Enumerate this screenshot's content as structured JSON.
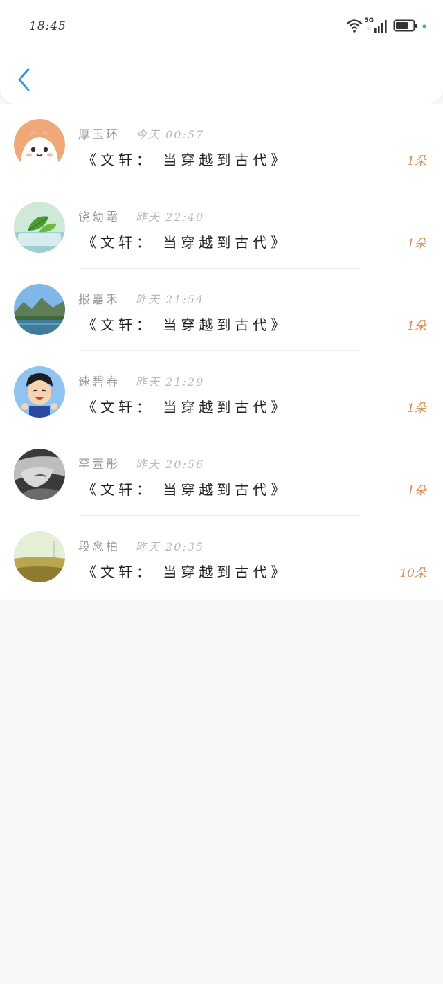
{
  "status_bar": {
    "time": "18:45",
    "network": "5G",
    "network_sub": "1l"
  },
  "nav": {
    "back_icon": "chevron-left-icon",
    "accent": "#3d97e4"
  },
  "records": [
    {
      "name": "厚玉环",
      "time": "今天 00:57",
      "book": "《文轩： 当穿越到古代》",
      "count": "1朵"
    },
    {
      "name": "饶幼霜",
      "time": "昨天 22:40",
      "book": "《文轩： 当穿越到古代》",
      "count": "1朵"
    },
    {
      "name": "报嘉禾",
      "time": "昨天 21:54",
      "book": "《文轩： 当穿越到古代》",
      "count": "1朵"
    },
    {
      "name": "速碧春",
      "time": "昨天 21:29",
      "book": "《文轩： 当穿越到古代》",
      "count": "1朵"
    },
    {
      "name": "罕萱彤",
      "time": "昨天 20:56",
      "book": "《文轩： 当穿越到古代》",
      "count": "1朵"
    },
    {
      "name": "段念柏",
      "time": "昨天 20:35",
      "book": "《文轩： 当穿越到古代》",
      "count": "10朵"
    }
  ],
  "colors": {
    "name": "#9a9a9a",
    "time": "#b9b9b9",
    "book": "#222222",
    "count": "#d6915a"
  }
}
